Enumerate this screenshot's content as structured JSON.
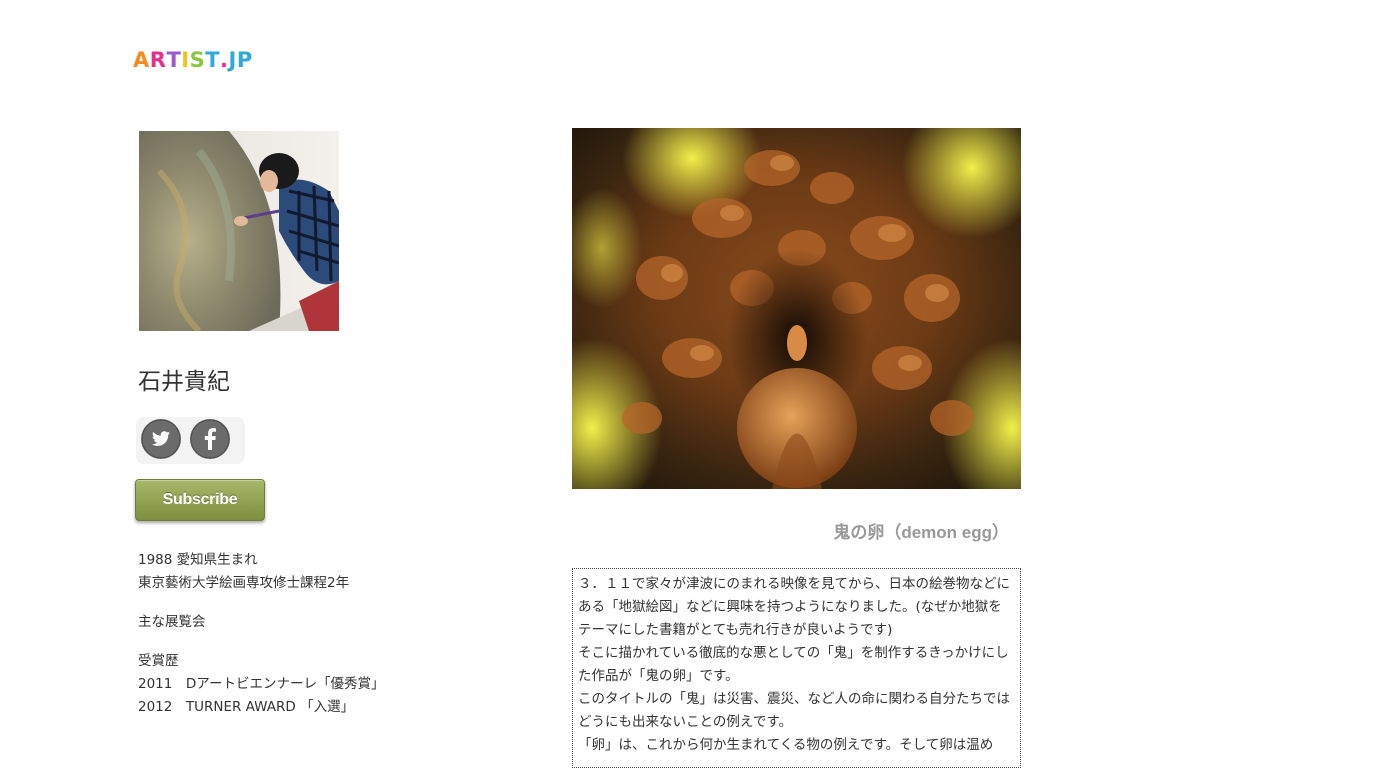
{
  "logo": {
    "letters": [
      {
        "char": "A",
        "color": "#f58b1f"
      },
      {
        "char": "R",
        "color": "#e8308a"
      },
      {
        "char": "T",
        "color": "#9b59d0"
      },
      {
        "char": "I",
        "color": "#f0c419"
      },
      {
        "char": "S",
        "color": "#8cc63f"
      },
      {
        "char": "T",
        "color": "#2eaadc"
      },
      {
        "char": ".",
        "color": "#e8308a"
      },
      {
        "char": "J",
        "color": "#2eaadc"
      },
      {
        "char": "P",
        "color": "#2eaadc"
      }
    ]
  },
  "artist": {
    "name": "石井貴紀"
  },
  "social": {
    "twitter_icon": "twitter-bird-icon",
    "facebook_icon": "facebook-f-icon"
  },
  "subscribe": {
    "label": "Subscribe",
    "color": "#8a9c4a"
  },
  "bio": {
    "birth": "1988 愛知県生まれ",
    "education": "東京藝術大学絵画専攻修士課程2年",
    "exhibitions_heading": "主な展覧会",
    "awards_heading": "受賞歴",
    "awards": [
      "2011　Dアートビエンナーレ「優秀賞」",
      "2012　TURNER AWARD 「入選」"
    ]
  },
  "work": {
    "title": "鬼の卵（demon egg）",
    "description": [
      "３．１１で家々が津波にのまれる映像を見てから、日本の絵巻物などにある「地獄絵図」などに興味を持つようになりました。(なぜか地獄をテーマにした書籍がとても売れ行きが良いようです)",
      "そこに描かれている徹底的な悪としての「鬼」を制作するきっかけにした作品が「鬼の卵」です。",
      "このタイトルの「鬼」は災害、震災、など人の命に関わる自分たちではどうにも出来ないことの例えです。",
      "「卵」は、これから何か生まれてくる物の例えです。そして卵は温め"
    ]
  }
}
